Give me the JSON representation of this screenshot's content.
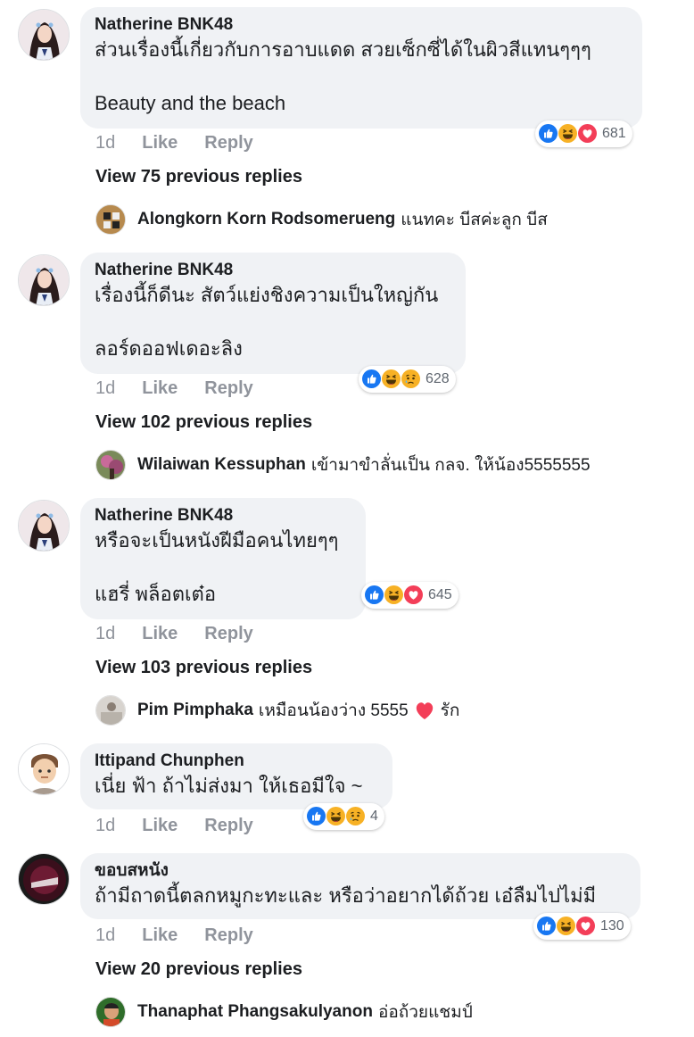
{
  "comments": [
    {
      "author": "Natherine BNK48",
      "text": "ส่วนเรื่องนี้เกี่ยวกับการอาบแดด สวยเซ็กซี่ได้ในผิวสีแทนๆๆๆ\n\nBeauty and the beach",
      "time": "1d",
      "like": "Like",
      "reply": "Reply",
      "reactions": [
        "like",
        "haha",
        "love"
      ],
      "reaction_count": "681",
      "view_previous": "View 75 previous replies",
      "latest_reply": {
        "author": "Alongkorn Korn Rodsomerueng",
        "text": "แนทคะ บีสค่ะลูก บีส"
      }
    },
    {
      "author": "Natherine BNK48",
      "text": "เรื่องนี้ก็ดีนะ สัตว์แย่งชิงความเป็นใหญ่กัน\n\nลอร์ดออฟเดอะลิง",
      "time": "1d",
      "like": "Like",
      "reply": "Reply",
      "reactions": [
        "like",
        "haha",
        "sad"
      ],
      "reaction_count": "628",
      "view_previous": "View 102 previous replies",
      "latest_reply": {
        "author": "Wilaiwan Kessuphan",
        "text": "เข้ามาขำลั่นเป็น กลจ. ให้น้อง5555555"
      }
    },
    {
      "author": "Natherine BNK48",
      "text": "หรือจะเป็นหนังฝีมือคนไทยๆๆ\n\nแฮรี่ พล็อตเต๋อ",
      "time": "1d",
      "like": "Like",
      "reply": "Reply",
      "reactions": [
        "like",
        "haha",
        "love"
      ],
      "reaction_count": "645",
      "view_previous": "View 103 previous replies",
      "latest_reply": {
        "author": "Pim Pimphaka",
        "text": "เหมือนน้องว่าง 5555",
        "text_after_heart": "รัก"
      }
    },
    {
      "author": "Ittipand Chunphen",
      "text": "เนี่ย ฟ้า ถ้าไม่ส่งมา ให้เธอมีใจ ~",
      "time": "1d",
      "like": "Like",
      "reply": "Reply",
      "reactions": [
        "like",
        "haha",
        "sad"
      ],
      "reaction_count": "4"
    },
    {
      "author": "ขอบสหนัง",
      "text": "ถ้ามีถาดนี้ตลกหมูกะทะและ หรือว่าอยากได้ถ้วย เอ๋ลืมไปไม่มี",
      "time": "1d",
      "like": "Like",
      "reply": "Reply",
      "reactions": [
        "like",
        "haha",
        "love"
      ],
      "reaction_count": "130",
      "view_previous": "View 20 previous replies",
      "latest_reply": {
        "author": "Thanaphat Phangsakulyanon",
        "text": "อ่อถ้วยแชมป์"
      }
    }
  ],
  "colors": {
    "like": "#1877f2",
    "haha": "#f7b125",
    "love": "#f33e58",
    "sad": "#f7b125",
    "meta": "#90949c",
    "bubble": "#f0f2f5"
  }
}
